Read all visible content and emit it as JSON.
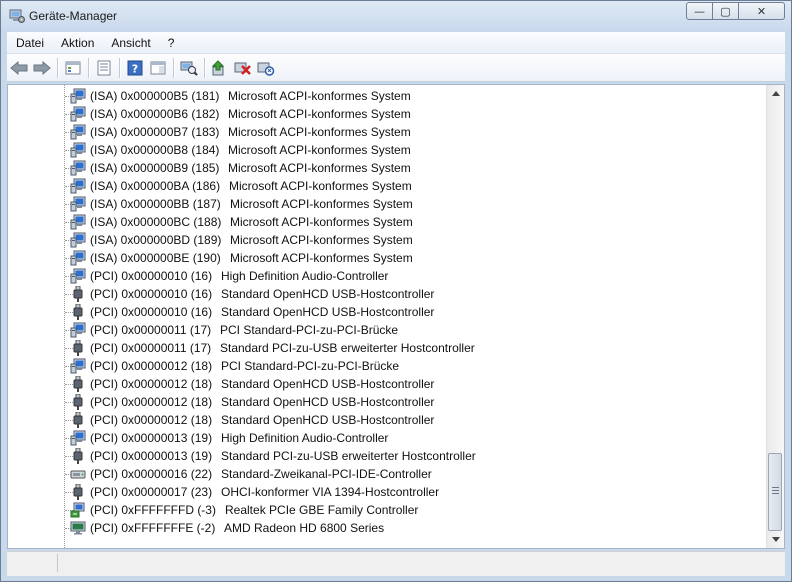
{
  "window": {
    "title": "Geräte-Manager",
    "minimize_glyph": "—",
    "maximize_glyph": "▢",
    "close_glyph": "✕"
  },
  "menubar": {
    "items": [
      "Datei",
      "Aktion",
      "Ansicht",
      "?"
    ]
  },
  "toolbar": {
    "buttons": [
      "back-icon",
      "forward-icon",
      "device-view-icon",
      "properties-icon",
      "help-icon",
      "panel-icon",
      "scan-hardware-icon",
      "update-driver-icon",
      "uninstall-icon",
      "disable-icon"
    ]
  },
  "tree": {
    "rows": [
      {
        "res": "(ISA) 0x000000B5 (181)",
        "name": "Microsoft ACPI-konformes System",
        "icon": "system"
      },
      {
        "res": "(ISA) 0x000000B6 (182)",
        "name": "Microsoft ACPI-konformes System",
        "icon": "system"
      },
      {
        "res": "(ISA) 0x000000B7 (183)",
        "name": "Microsoft ACPI-konformes System",
        "icon": "system"
      },
      {
        "res": "(ISA) 0x000000B8 (184)",
        "name": "Microsoft ACPI-konformes System",
        "icon": "system"
      },
      {
        "res": "(ISA) 0x000000B9 (185)",
        "name": "Microsoft ACPI-konformes System",
        "icon": "system"
      },
      {
        "res": "(ISA) 0x000000BA (186)",
        "name": "Microsoft ACPI-konformes System",
        "icon": "system"
      },
      {
        "res": "(ISA) 0x000000BB (187)",
        "name": "Microsoft ACPI-konformes System",
        "icon": "system"
      },
      {
        "res": "(ISA) 0x000000BC (188)",
        "name": "Microsoft ACPI-konformes System",
        "icon": "system"
      },
      {
        "res": "(ISA) 0x000000BD (189)",
        "name": "Microsoft ACPI-konformes System",
        "icon": "system"
      },
      {
        "res": "(ISA) 0x000000BE (190)",
        "name": "Microsoft ACPI-konformes System",
        "icon": "system"
      },
      {
        "res": "(PCI) 0x00000010 (16)",
        "name": "High Definition Audio-Controller",
        "icon": "system"
      },
      {
        "res": "(PCI) 0x00000010 (16)",
        "name": "Standard OpenHCD USB-Hostcontroller",
        "icon": "usb"
      },
      {
        "res": "(PCI) 0x00000010 (16)",
        "name": "Standard OpenHCD USB-Hostcontroller",
        "icon": "usb"
      },
      {
        "res": "(PCI) 0x00000011 (17)",
        "name": "PCI Standard-PCI-zu-PCI-Brücke",
        "icon": "system"
      },
      {
        "res": "(PCI) 0x00000011 (17)",
        "name": "Standard PCI-zu-USB erweiterter Hostcontroller",
        "icon": "usb"
      },
      {
        "res": "(PCI) 0x00000012 (18)",
        "name": "PCI Standard-PCI-zu-PCI-Brücke",
        "icon": "system"
      },
      {
        "res": "(PCI) 0x00000012 (18)",
        "name": "Standard OpenHCD USB-Hostcontroller",
        "icon": "usb"
      },
      {
        "res": "(PCI) 0x00000012 (18)",
        "name": "Standard OpenHCD USB-Hostcontroller",
        "icon": "usb"
      },
      {
        "res": "(PCI) 0x00000012 (18)",
        "name": "Standard OpenHCD USB-Hostcontroller",
        "icon": "usb"
      },
      {
        "res": "(PCI) 0x00000013 (19)",
        "name": "High Definition Audio-Controller",
        "icon": "system"
      },
      {
        "res": "(PCI) 0x00000013 (19)",
        "name": "Standard PCI-zu-USB erweiterter Hostcontroller",
        "icon": "usb"
      },
      {
        "res": "(PCI) 0x00000016 (22)",
        "name": "Standard-Zweikanal-PCI-IDE-Controller",
        "icon": "ide"
      },
      {
        "res": "(PCI) 0x00000017 (23)",
        "name": "OHCI-konformer VIA 1394-Hostcontroller",
        "icon": "usb"
      },
      {
        "res": "(PCI) 0xFFFFFFFD (-3)",
        "name": "Realtek PCIe GBE Family Controller",
        "icon": "network"
      },
      {
        "res": "(PCI) 0xFFFFFFFE (-2)",
        "name": "AMD Radeon HD 6800 Series",
        "icon": "display"
      }
    ]
  },
  "colors": {
    "accent": "#1c4f9c",
    "title_bg": "#c9d9ec"
  }
}
